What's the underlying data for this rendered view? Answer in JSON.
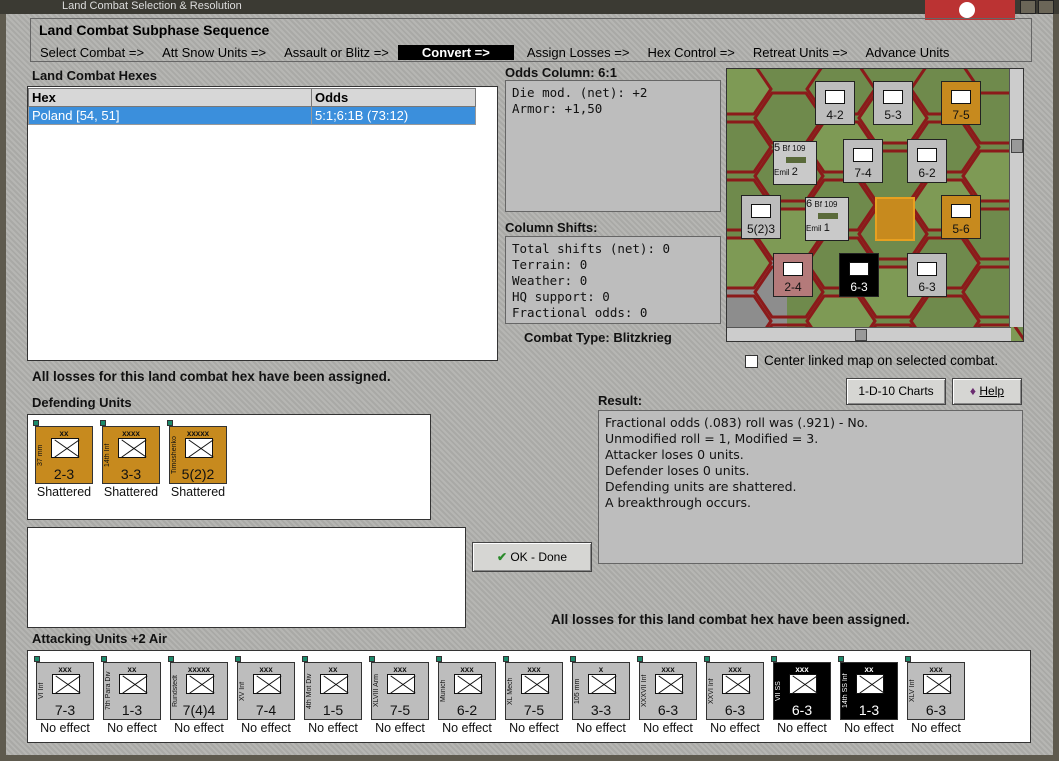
{
  "window": {
    "title": "Land Combat Selection & Resolution"
  },
  "sequence": {
    "title": "Land Combat Subphase Sequence",
    "steps": [
      "Select Combat =>",
      "Att Snow Units =>",
      "Assault or Blitz =>",
      "Convert =>",
      "Assign Losses =>",
      "Hex Control =>",
      "Retreat Units =>",
      "Advance Units"
    ],
    "active_index": 3
  },
  "hexes": {
    "label": "Land Combat Hexes",
    "columns": [
      "Hex",
      "Odds"
    ],
    "rows": [
      {
        "hex": "Poland [54, 51]",
        "odds": "5:1;6:1B (73:12)"
      }
    ]
  },
  "odds": {
    "title": "Odds Column: 6:1",
    "lines": [
      "Die mod. (net): +2",
      "Armor: +1,50"
    ]
  },
  "shifts": {
    "title": "Column Shifts:",
    "lines": [
      "Total shifts (net): 0",
      "Terrain: 0",
      "Weather: 0",
      "HQ support: 0",
      "Fractional odds: 0"
    ]
  },
  "combat_type": {
    "label": "Combat Type:",
    "value": "Blitzkrieg"
  },
  "center_map": {
    "label": "Center linked map on selected combat.",
    "checked": false
  },
  "buttons": {
    "charts": "1-D-10 Charts",
    "help": "Help",
    "done": "OK - Done"
  },
  "messages": {
    "losses_assigned": "All losses for this land combat hex have been assigned."
  },
  "defending": {
    "label": "Defending Units",
    "units": [
      {
        "size": "xx",
        "name": "37 mm",
        "value": "2-3",
        "status": "Shattered",
        "color": "#c78a1e"
      },
      {
        "size": "xxxx",
        "name": "14th Inf",
        "value": "3-3",
        "status": "Shattered",
        "color": "#c78a1e"
      },
      {
        "size": "xxxxx",
        "name": "Timoshenko",
        "value": "5(2)2",
        "status": "Shattered",
        "color": "#c78a1e"
      }
    ]
  },
  "result": {
    "label": "Result:",
    "lines": [
      "Fractional odds (.083) roll was (.921)  - No.",
      "Unmodified roll = 1, Modified = 3.",
      "Attacker loses 0 units.",
      "Defender loses 0 units.",
      "Defending units are shattered.",
      "A breakthrough occurs."
    ]
  },
  "attacking": {
    "label": "Attacking Units +2 Air",
    "units": [
      {
        "size": "xxx",
        "name": "VI Inf",
        "value": "7-3",
        "status": "No effect",
        "color": "#bdbdbd"
      },
      {
        "size": "xx",
        "name": "7th Para Div",
        "value": "1-3",
        "status": "No effect",
        "color": "#bdbdbd"
      },
      {
        "size": "xxxxx",
        "name": "Rundstedt",
        "value": "7(4)4",
        "status": "No effect",
        "color": "#bdbdbd"
      },
      {
        "size": "xxx",
        "name": "XV Inf",
        "value": "7-4",
        "status": "No effect",
        "color": "#bdbdbd"
      },
      {
        "size": "xx",
        "name": "4th Mot Div",
        "value": "1-5",
        "status": "No effect",
        "color": "#bdbdbd"
      },
      {
        "size": "xxx",
        "name": "XLVIII Arm",
        "value": "7-5",
        "status": "No effect",
        "color": "#bdbdbd"
      },
      {
        "size": "xxx",
        "name": "Munich",
        "value": "6-2",
        "status": "No effect",
        "color": "#bdbdbd"
      },
      {
        "size": "xxx",
        "name": "XL Mech",
        "value": "7-5",
        "status": "No effect",
        "color": "#bdbdbd"
      },
      {
        "size": "x",
        "name": "105 mm",
        "value": "3-3",
        "status": "No effect",
        "color": "#bdbdbd"
      },
      {
        "size": "xxx",
        "name": "XXXVII Inf",
        "value": "6-3",
        "status": "No effect",
        "color": "#bdbdbd"
      },
      {
        "size": "xxx",
        "name": "XXVI Inf",
        "value": "6-3",
        "status": "No effect",
        "color": "#bdbdbd"
      },
      {
        "size": "xxx",
        "name": "VII SS",
        "value": "6-3",
        "status": "No effect",
        "color": "#000000"
      },
      {
        "size": "xx",
        "name": "14th SS Inf",
        "value": "1-3",
        "status": "No effect",
        "color": "#000000"
      },
      {
        "size": "xxx",
        "name": "XLV Inf",
        "value": "6-3",
        "status": "No effect",
        "color": "#bdbdbd"
      }
    ]
  },
  "map_counters": [
    {
      "value": "4-2"
    },
    {
      "value": "5-3"
    },
    {
      "value": "7-5"
    },
    {
      "value": "7-4"
    },
    {
      "value": "6-2"
    },
    {
      "value": "5(2)3"
    },
    {
      "value": "5-6"
    },
    {
      "value": "2-4"
    },
    {
      "value": "6-3"
    },
    {
      "value": "6-3"
    }
  ],
  "map_air": [
    {
      "label": "Bf 109",
      "num": "5",
      "sub": "Emil",
      "val": "2"
    },
    {
      "label": "Bf 109",
      "num": "6",
      "sub": "Emil",
      "val": "1"
    }
  ]
}
